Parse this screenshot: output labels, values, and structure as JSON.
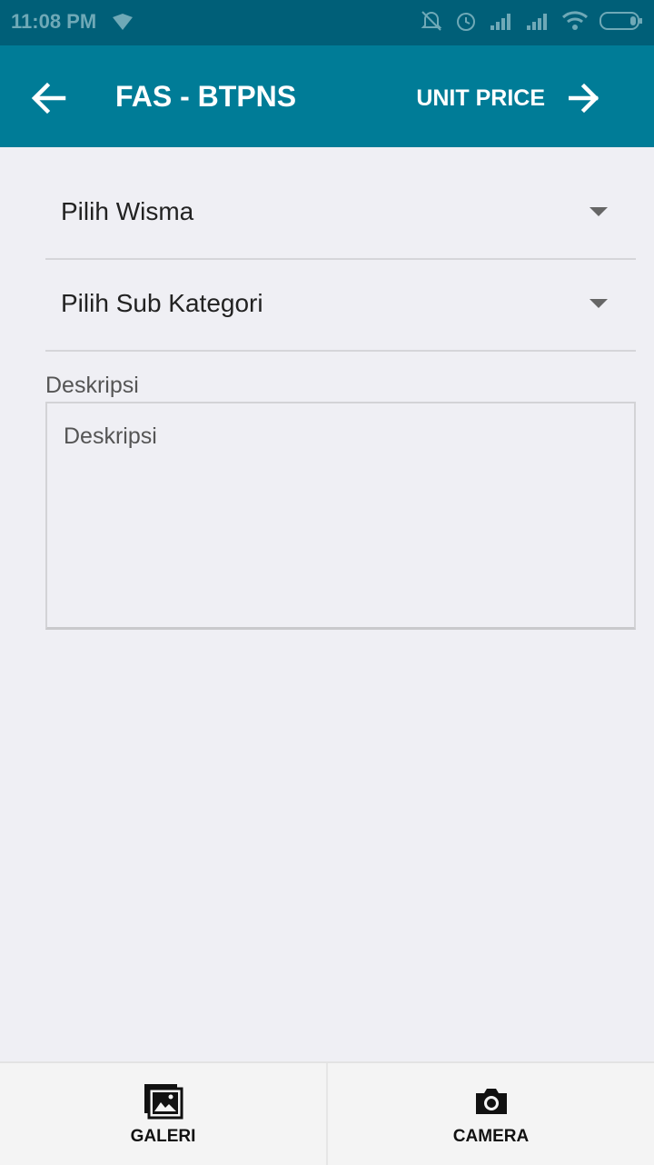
{
  "status_bar": {
    "time": "11:08 PM"
  },
  "app_bar": {
    "title": "FAS - BTPNS",
    "next_label": "UNIT PRICE"
  },
  "form": {
    "wisma_select": {
      "selected": "Pilih Wisma"
    },
    "sub_kategori_select": {
      "selected": "Pilih Sub Kategori"
    },
    "deskripsi": {
      "label": "Deskripsi",
      "placeholder": "Deskripsi",
      "value": ""
    }
  },
  "bottom_bar": {
    "galeri_label": "GALERI",
    "camera_label": "CAMERA"
  },
  "colors": {
    "status_bar": "#005f78",
    "app_bar": "#007c97",
    "background": "#efeff4"
  }
}
